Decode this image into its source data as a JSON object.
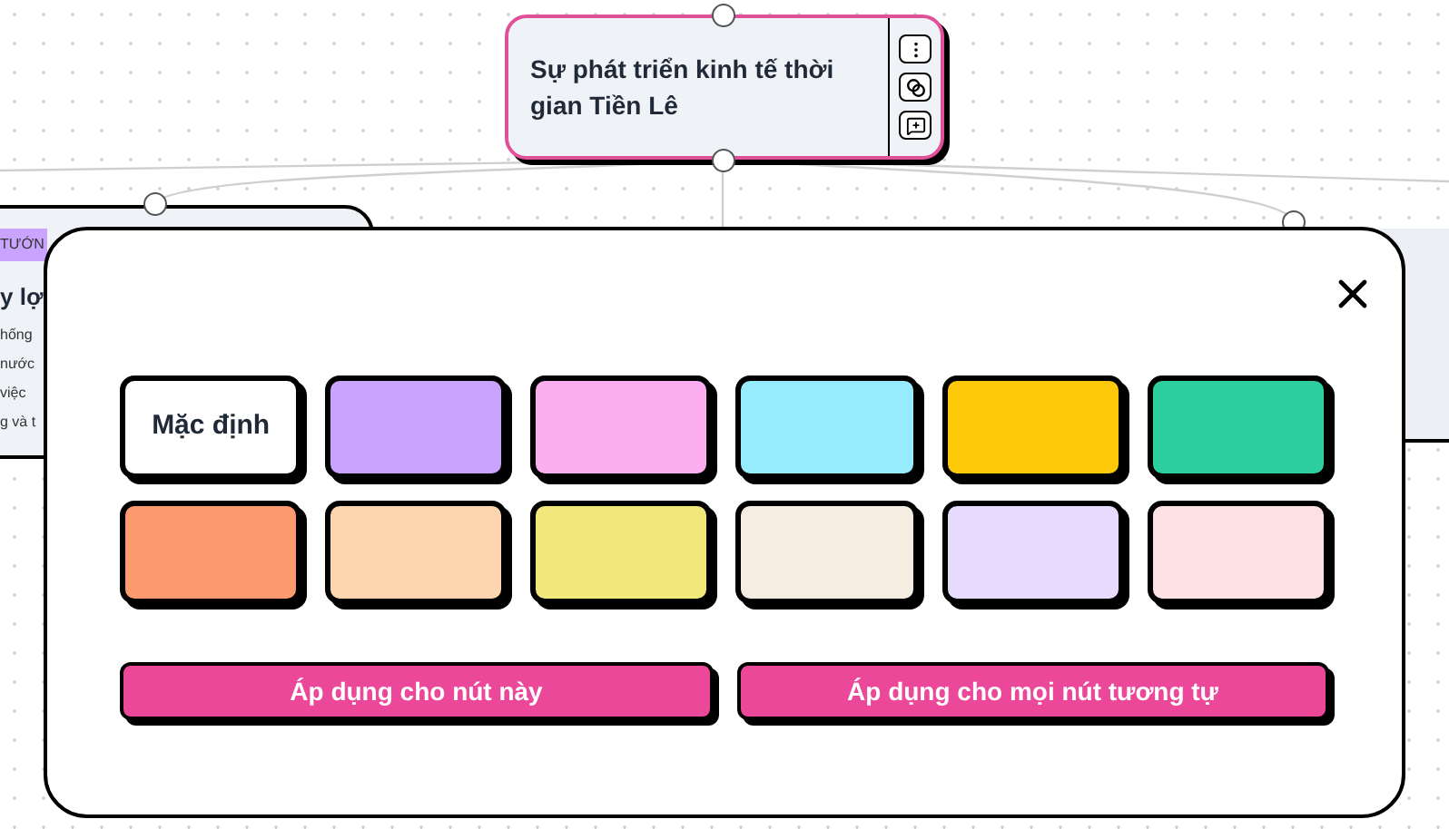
{
  "mind_map": {
    "central_node": {
      "title": "Sự phát triển kinh tế thời gian Tiền Lê"
    },
    "side_node": {
      "tag": "TƯỚN",
      "title": "y lợ",
      "lines": [
        "hống",
        "nước",
        "việc",
        "g và t"
      ]
    }
  },
  "color_dialog": {
    "swatches": [
      {
        "kind": "default",
        "label": "Mặc định"
      },
      {
        "kind": "color",
        "color": "#c9a3fd"
      },
      {
        "kind": "color",
        "color": "#fdaef0"
      },
      {
        "kind": "color",
        "color": "#96ebfd"
      },
      {
        "kind": "color",
        "color": "#fdc90a"
      },
      {
        "kind": "color",
        "color": "#2ecf9f"
      },
      {
        "kind": "color",
        "color": "#fd9b6f"
      },
      {
        "kind": "color",
        "color": "#fdd5ae"
      },
      {
        "kind": "color",
        "color": "#f2e77a"
      },
      {
        "kind": "color",
        "color": "#f6ede2"
      },
      {
        "kind": "color",
        "color": "#e7dbfd"
      },
      {
        "kind": "color",
        "color": "#fde0e1"
      }
    ],
    "buttons": [
      "Áp dụng cho nút này",
      "Áp dụng cho mọi nút tương tự"
    ]
  }
}
